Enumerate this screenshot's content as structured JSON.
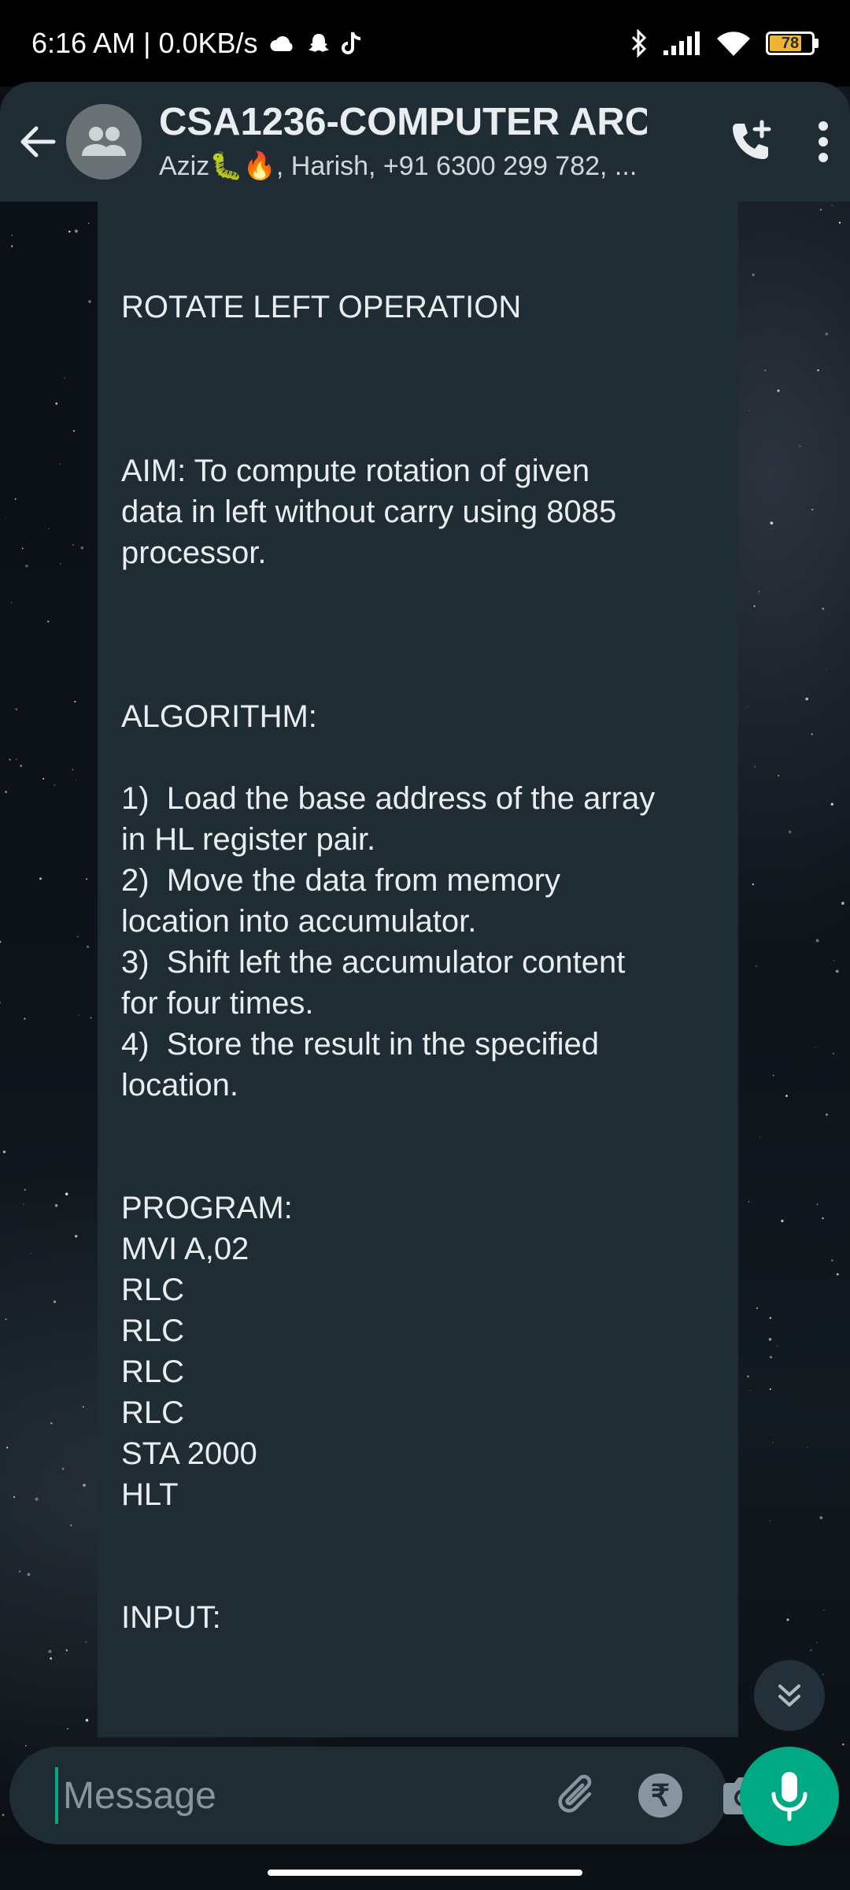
{
  "status": {
    "time_speed": "6:16 AM | 0.0KB/s",
    "battery": "78",
    "battery_percent": 78
  },
  "header": {
    "title": "CSA1236-COMPUTER ARC...",
    "members": "Aziz🐛🔥, Harish, +91 6300 299 782, ..."
  },
  "message": {
    "lines": [
      "ROTATE LEFT OPERATION",
      "AIM: To compute rotation of given",
      "data in left without carry using 8085",
      "processor.",
      "ALGORITHM:",
      "1)  Load the base address of the array",
      "in HL register pair.",
      "2)  Move the data from memory",
      "location into accumulator.",
      "3)  Shift left the accumulator content",
      "for four times.",
      "4)  Store the result in the specified",
      "location.",
      "PROGRAM:",
      "MVI A,02",
      "RLC",
      "RLC",
      "RLC",
      "RLC",
      "STA 2000",
      "HLT",
      "INPUT:"
    ]
  },
  "input": {
    "placeholder": "Message",
    "rupee_symbol": "₹"
  },
  "colors": {
    "accent": "#00a884",
    "panel": "#1f2c34",
    "battery": "#f2b233"
  },
  "icons": [
    "cloud-icon",
    "snapchat-icon",
    "tiktok-icon",
    "bluetooth-icon",
    "signal-icon",
    "wifi-icon",
    "battery-icon",
    "back-arrow-icon",
    "group-avatar-icon",
    "add-call-icon",
    "more-vert-icon",
    "scroll-down-icon",
    "emoji-icon",
    "attach-icon",
    "rupee-icon",
    "camera-icon",
    "mic-icon"
  ]
}
